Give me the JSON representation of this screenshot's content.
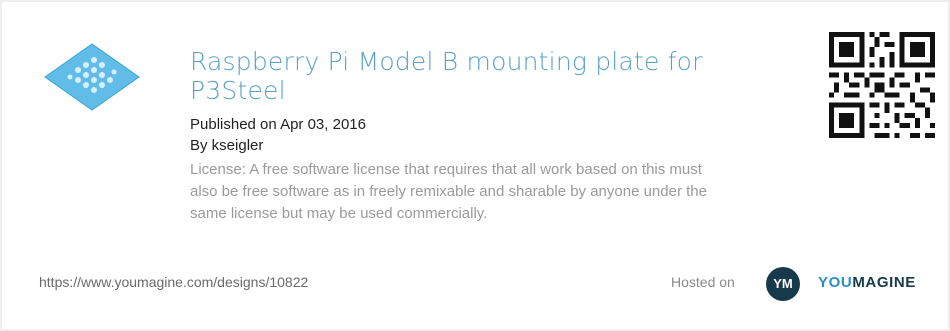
{
  "design": {
    "title": "Raspberry Pi Model B mounting plate for P3Steel",
    "published": "Published on Apr 03, 2016",
    "author": "By kseigler",
    "license": "License: A free software license that requires that all work based on this must also be free software as in freely remixable and sharable by anyone under the same license but may be used commercially.",
    "thumbnail_icon": "plate-thumbnail-icon",
    "qr_icon": "qr-code-icon"
  },
  "footer": {
    "url": "https://www.youmagine.com/designs/10822",
    "hosted_label": "Hosted on",
    "logo_badge": "YM",
    "logo_word_part1": "YOU",
    "logo_word_part2": "MAGINE"
  },
  "colors": {
    "title": "#5aa0c8",
    "license_text": "#9a9a9a",
    "brand_dark": "#173a4a",
    "brand_blue": "#2a8fbf",
    "thumbnail": "#61bde8"
  }
}
